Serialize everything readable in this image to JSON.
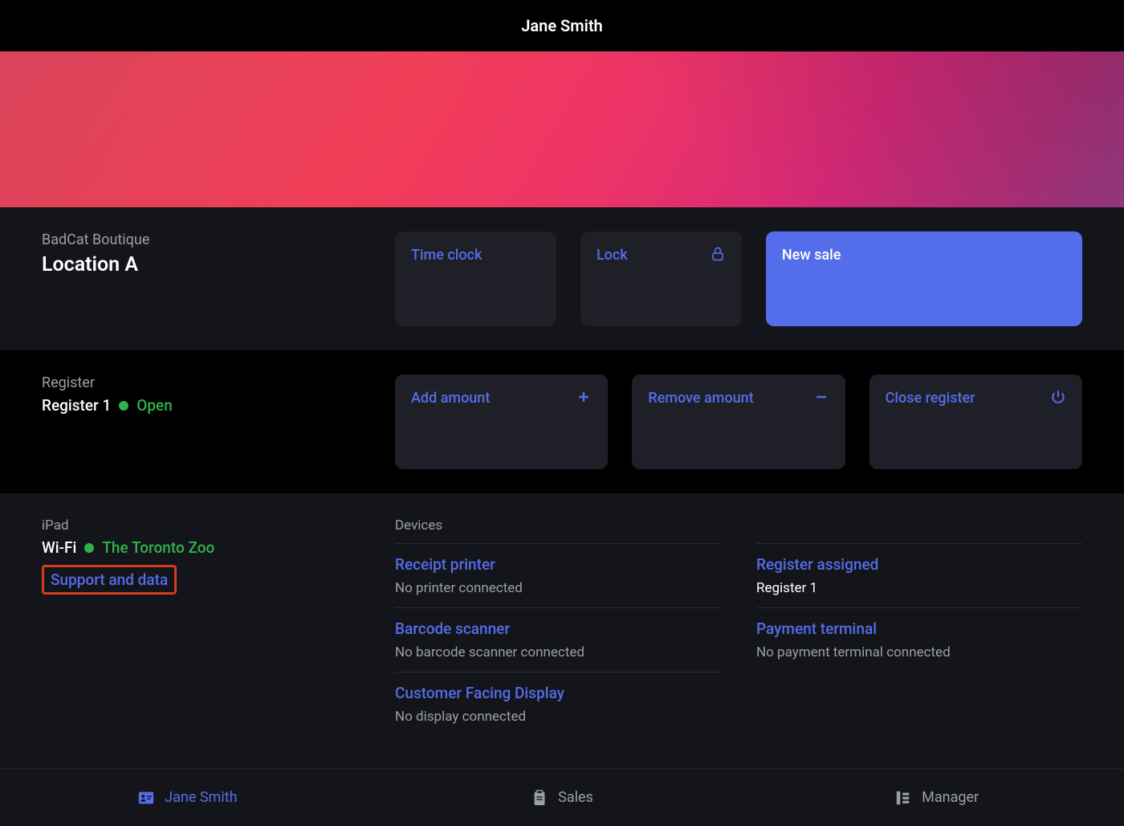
{
  "header": {
    "title": "Jane Smith"
  },
  "store": {
    "name": "BadCat Boutique",
    "location": "Location A",
    "actions": {
      "time_clock": "Time clock",
      "lock": "Lock",
      "new_sale": "New sale"
    }
  },
  "register": {
    "label": "Register",
    "name": "Register 1",
    "status": "Open",
    "actions": {
      "add_amount": "Add amount",
      "remove_amount": "Remove amount",
      "close_register": "Close register"
    }
  },
  "ipad": {
    "label": "iPad",
    "wifi_label": "Wi-Fi",
    "wifi_network": "The Toronto Zoo",
    "support_link": "Support and data"
  },
  "devices": {
    "header": "Devices",
    "left_col": [
      {
        "title": "Receipt printer",
        "status": "No printer connected"
      },
      {
        "title": "Barcode scanner",
        "status": "No barcode scanner connected"
      },
      {
        "title": "Customer Facing Display",
        "status": "No display connected"
      }
    ],
    "right_col": [
      {
        "title": "Register assigned",
        "status": "Register 1",
        "white": true
      },
      {
        "title": "Payment terminal",
        "status": "No payment terminal connected"
      }
    ]
  },
  "tabs": {
    "profile": "Jane Smith",
    "sales": "Sales",
    "manager": "Manager"
  },
  "colors": {
    "accent": "#546dea",
    "success": "#2fb34a",
    "highlight_border": "#d43b1f"
  }
}
